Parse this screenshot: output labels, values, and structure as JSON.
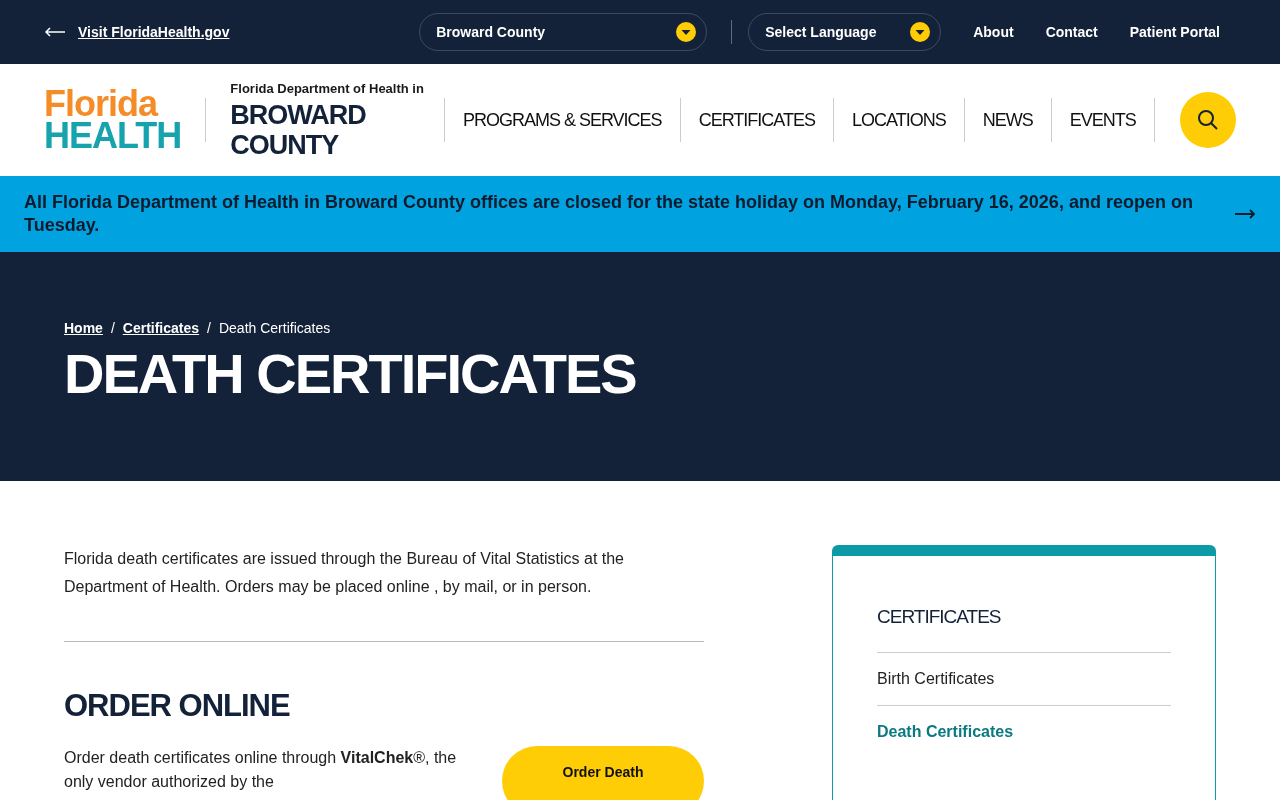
{
  "utility_bar": {
    "back_link": "Visit FloridaHealth.gov",
    "county_select": {
      "value": "Broward County"
    },
    "language_select": {
      "value": "Select Language"
    },
    "links": [
      "About",
      "Contact",
      "Patient Portal"
    ]
  },
  "header": {
    "logo": {
      "line_1": "Florida",
      "line_2": "HEALTH"
    },
    "subtitle": "Florida Department of Health in",
    "title": "BROWARD COUNTY",
    "nav": [
      {
        "label": "PROGRAMS & SERVICES",
        "selected": false
      },
      {
        "label": "CERTIFICATES",
        "selected": false
      },
      {
        "label": "LOCATIONS",
        "selected": false
      },
      {
        "label": "NEWS",
        "selected": false
      },
      {
        "label": "EVENTS",
        "selected": false
      }
    ]
  },
  "alert": {
    "text": "All Florida Department of Health in Broward County offices are closed for the state holiday on Monday, February 16, 2026, and reopen on Tuesday."
  },
  "hero": {
    "breadcrumbs": [
      {
        "label": "Home",
        "kind": "link"
      },
      {
        "label": "/",
        "kind": "separator"
      },
      {
        "label": "Certificates",
        "kind": "link"
      },
      {
        "label": "/",
        "kind": "separator"
      },
      {
        "label": "Death Certificates",
        "kind": "current"
      }
    ],
    "title": "DEATH CERTIFICATES"
  },
  "main": {
    "intro": "Florida death certificates are issued through the Bureau of Vital Statistics at the Department of Health. Orders may be placed online , by mail, or in person.",
    "section_title": "ORDER ONLINE",
    "section_text": "Order death certificates online through **VitalChek**®, the only vendor authorized by the",
    "order_button": "Order Death"
  },
  "sidebar": {
    "title": "CERTIFICATES",
    "items": [
      {
        "label": "Birth Certificates",
        "selected": false
      },
      {
        "label": "Death Certificates",
        "selected": true
      }
    ]
  }
}
